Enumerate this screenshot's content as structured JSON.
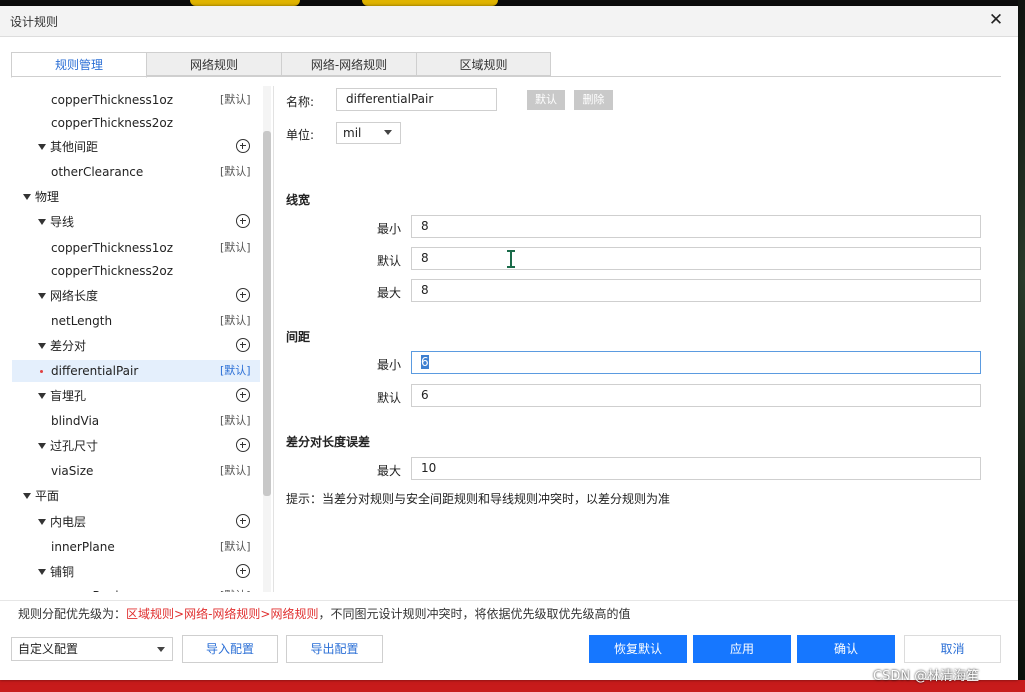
{
  "window": {
    "title": "设计规则"
  },
  "tabs": [
    {
      "label": "规则管理",
      "active": true
    },
    {
      "label": "网络规则",
      "active": false
    },
    {
      "label": "网络-网络规则",
      "active": false
    },
    {
      "label": "区域规则",
      "active": false
    }
  ],
  "tree": {
    "default_tag": "[默认]",
    "items": [
      {
        "label": "copperThickness1oz"
      },
      {
        "label": "copperThickness2oz"
      },
      {
        "label": "其他间距"
      },
      {
        "label": "otherClearance"
      },
      {
        "label": "物理"
      },
      {
        "label": "导线"
      },
      {
        "label": "copperThickness1oz"
      },
      {
        "label": "copperThickness2oz"
      },
      {
        "label": "网络长度"
      },
      {
        "label": "netLength"
      },
      {
        "label": "差分对"
      },
      {
        "label": "differentialPair"
      },
      {
        "label": "盲埋孔"
      },
      {
        "label": "blindVia"
      },
      {
        "label": "过孔尺寸"
      },
      {
        "label": "viaSize"
      },
      {
        "label": "平面"
      },
      {
        "label": "内电层"
      },
      {
        "label": "innerPlane"
      },
      {
        "label": "铺铜"
      },
      {
        "label": "copperRegion"
      }
    ]
  },
  "form": {
    "name_label": "名称:",
    "name_value": "differentialPair",
    "default_btn": "默认",
    "delete_btn": "删除",
    "unit_label": "单位:",
    "unit_value": "mil",
    "linewidth": {
      "title": "线宽",
      "min_label": "最小",
      "min": "8",
      "default_label": "默认",
      "default": "8",
      "max_label": "最大",
      "max": "8"
    },
    "spacing": {
      "title": "间距",
      "min_label": "最小",
      "min": "6",
      "default_label": "默认",
      "default": "6"
    },
    "length_tol": {
      "title": "差分对长度误差",
      "max_label": "最大",
      "max": "10"
    },
    "hint": "提示：当差分对规则与安全间距规则和导线规则冲突时，以差分规则为准"
  },
  "priority": {
    "prefix": "规则分配优先级为：",
    "chain": "区域规则>网络-网络规则>网络规则",
    "suffix": "，不同图元设计规则冲突时，将依据优先级取优先级高的值"
  },
  "footer": {
    "config_select": "自定义配置",
    "import_btn": "导入配置",
    "export_btn": "导出配置",
    "restore_btn": "恢复默认",
    "apply_btn": "应用",
    "ok_btn": "确认",
    "cancel_btn": "取消"
  },
  "watermark": "CSDN @林清海笙",
  "colors": {
    "accent": "#1677ff",
    "tab_active": "#2b6fd6",
    "priority_red": "#e03030"
  }
}
